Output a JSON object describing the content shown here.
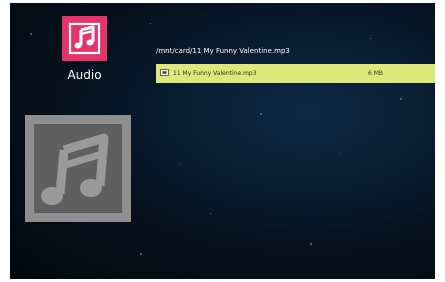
{
  "app": {
    "name": "Audio",
    "icon": "music-note-icon",
    "accent_color": "#e8336a"
  },
  "preview": {
    "icon": "music-note-icon"
  },
  "browser": {
    "path": "/mnt/card/11 My Funny Valentine.mp3",
    "files": [
      {
        "icon": "audio-file-icon",
        "name": "11 My Funny Valentine.mp3",
        "size": "6  MB",
        "selected": true
      }
    ],
    "highlight_color": "#ddea7a"
  }
}
